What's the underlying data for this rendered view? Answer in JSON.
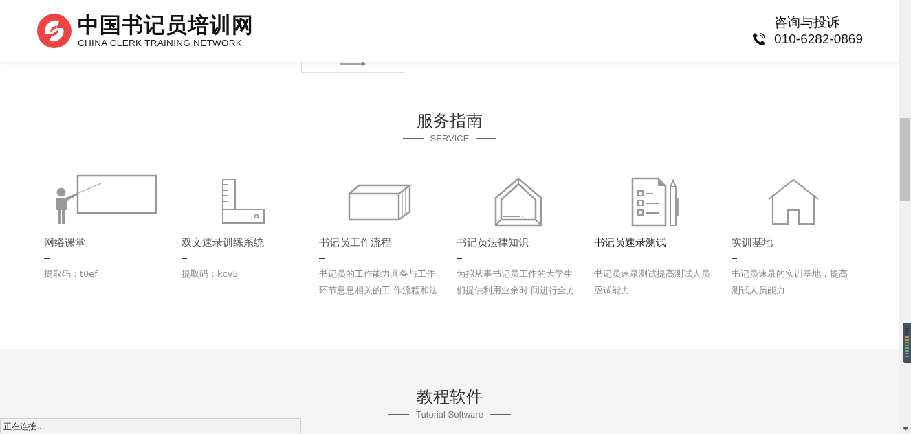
{
  "header": {
    "logo_title": "中国书记员培训网",
    "logo_subtitle": "CHINA CLERK TRAINING NETWORK",
    "contact_label": "咨询与投诉",
    "phone": "010-6282-0869"
  },
  "services_section": {
    "title": "服务指南",
    "subtitle": "SERVICE",
    "items": [
      {
        "kind": "classroom",
        "title": "网络课堂",
        "description": "提取码：t0ef",
        "selected": false
      },
      {
        "kind": "ruler",
        "title": "双文速录训练系统",
        "description": "提取码：kcv5",
        "selected": false
      },
      {
        "kind": "box",
        "title": "书记员工作流程",
        "description": "书记员的工作能力具备与工作环节息息相关的工 作流程和法",
        "selected": false
      },
      {
        "kind": "frame",
        "title": "书记员法律知识",
        "description": "为拟从事书记员工作的大学生们提供利用业余时 间进行全方",
        "selected": false
      },
      {
        "kind": "checklist",
        "title": "书记员速录测试",
        "description": "书记员速录测试提高测试人员应试能力",
        "selected": true
      },
      {
        "kind": "house",
        "title": "实训基地",
        "description": "书记员速录的实训基地，提高测试人员能力",
        "selected": false
      }
    ]
  },
  "software_section": {
    "title": "教程软件",
    "subtitle": "Tutorial Software"
  },
  "status_bar": {
    "text": "正在连接..."
  }
}
